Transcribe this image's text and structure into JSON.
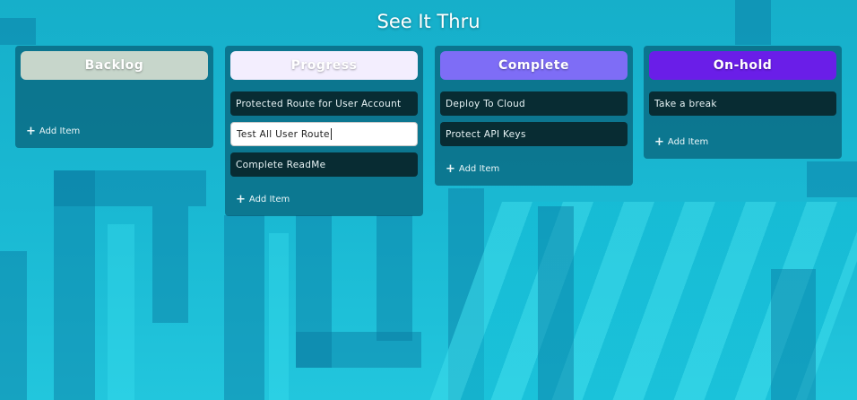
{
  "app": {
    "title": "See It Thru"
  },
  "columns": [
    {
      "name": "Backlog",
      "color": "#c7d6cb",
      "items": [],
      "add_label": "Add Item"
    },
    {
      "name": "Progress",
      "color": "#f3eefe",
      "items": [
        "Protected Route for User Account",
        "Test All User Route",
        "Complete ReadMe"
      ],
      "editing_index": 1,
      "add_label": "Add Item"
    },
    {
      "name": "Complete",
      "color": "#7e6df6",
      "items": [
        "Deploy To Cloud",
        "Protect API Keys"
      ],
      "add_label": "Add Item"
    },
    {
      "name": "On-hold",
      "color": "#6a1ee8",
      "items": [
        "Take a break"
      ],
      "add_label": "Add Item"
    }
  ],
  "icons": {
    "add": "plus-icon"
  }
}
